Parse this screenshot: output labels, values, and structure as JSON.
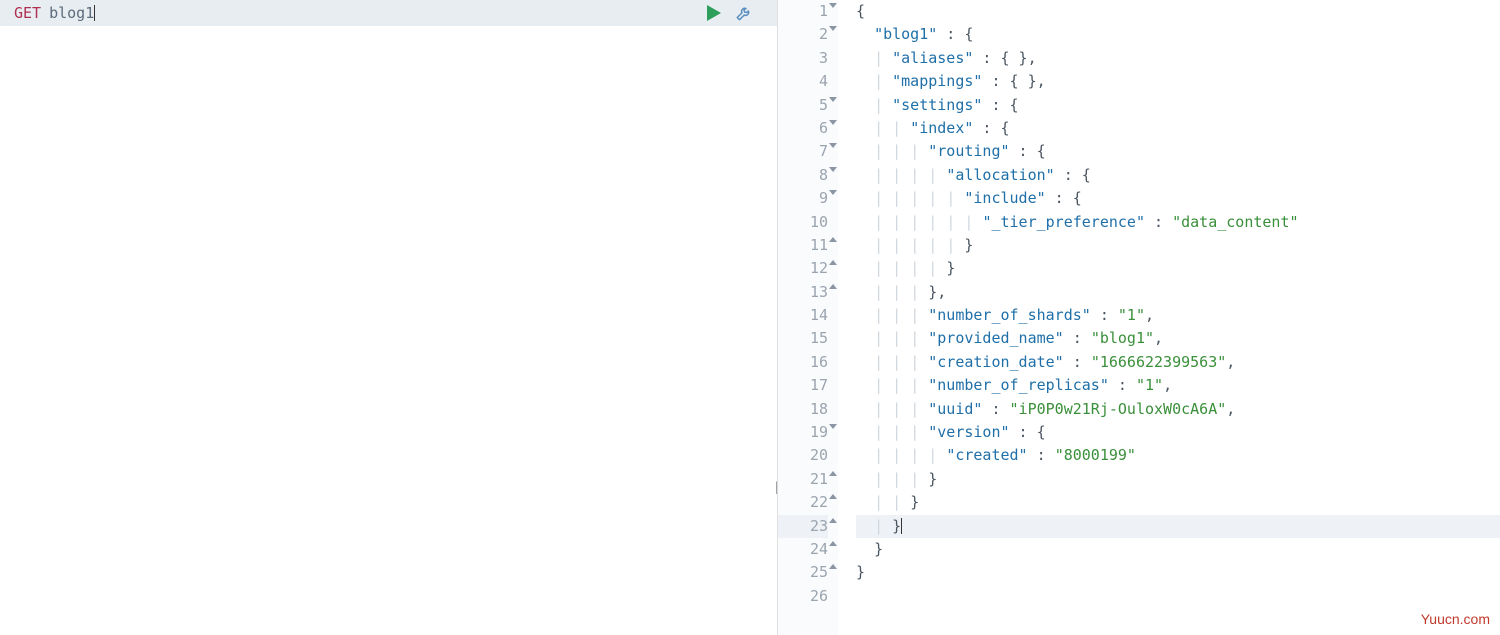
{
  "editor": {
    "method": "GET",
    "argument": "blog1"
  },
  "response": {
    "lines": [
      {
        "n": 1,
        "fold": "open",
        "indent": 0,
        "guides": 0,
        "tokens": [
          [
            "punc",
            "{"
          ]
        ]
      },
      {
        "n": 2,
        "fold": "open",
        "indent": 1,
        "guides": 0,
        "tokens": [
          [
            "key",
            "\"blog1\""
          ],
          [
            "punc",
            " : {"
          ]
        ]
      },
      {
        "n": 3,
        "fold": null,
        "indent": 2,
        "guides": 1,
        "tokens": [
          [
            "key",
            "\"aliases\""
          ],
          [
            "punc",
            " : { },"
          ]
        ]
      },
      {
        "n": 4,
        "fold": null,
        "indent": 2,
        "guides": 1,
        "tokens": [
          [
            "key",
            "\"mappings\""
          ],
          [
            "punc",
            " : { },"
          ]
        ]
      },
      {
        "n": 5,
        "fold": "open",
        "indent": 2,
        "guides": 1,
        "tokens": [
          [
            "key",
            "\"settings\""
          ],
          [
            "punc",
            " : {"
          ]
        ]
      },
      {
        "n": 6,
        "fold": "open",
        "indent": 3,
        "guides": 2,
        "tokens": [
          [
            "key",
            "\"index\""
          ],
          [
            "punc",
            " : {"
          ]
        ]
      },
      {
        "n": 7,
        "fold": "open",
        "indent": 4,
        "guides": 3,
        "tokens": [
          [
            "key",
            "\"routing\""
          ],
          [
            "punc",
            " : {"
          ]
        ]
      },
      {
        "n": 8,
        "fold": "open",
        "indent": 5,
        "guides": 4,
        "tokens": [
          [
            "key",
            "\"allocation\""
          ],
          [
            "punc",
            " : {"
          ]
        ]
      },
      {
        "n": 9,
        "fold": "open",
        "indent": 6,
        "guides": 5,
        "tokens": [
          [
            "key",
            "\"include\""
          ],
          [
            "punc",
            " : {"
          ]
        ]
      },
      {
        "n": 10,
        "fold": null,
        "indent": 7,
        "guides": 6,
        "tokens": [
          [
            "key",
            "\"_tier_preference\""
          ],
          [
            "punc",
            " : "
          ],
          [
            "str",
            "\"data_content\""
          ]
        ]
      },
      {
        "n": 11,
        "fold": "close",
        "indent": 6,
        "guides": 6,
        "tokens": [
          [
            "punc",
            "}"
          ]
        ]
      },
      {
        "n": 12,
        "fold": "close",
        "indent": 5,
        "guides": 5,
        "tokens": [
          [
            "punc",
            "}"
          ]
        ]
      },
      {
        "n": 13,
        "fold": "close",
        "indent": 4,
        "guides": 4,
        "tokens": [
          [
            "punc",
            "},"
          ]
        ]
      },
      {
        "n": 14,
        "fold": null,
        "indent": 4,
        "guides": 3,
        "tokens": [
          [
            "key",
            "\"number_of_shards\""
          ],
          [
            "punc",
            " : "
          ],
          [
            "str",
            "\"1\""
          ],
          [
            "punc",
            ","
          ]
        ]
      },
      {
        "n": 15,
        "fold": null,
        "indent": 4,
        "guides": 3,
        "tokens": [
          [
            "key",
            "\"provided_name\""
          ],
          [
            "punc",
            " : "
          ],
          [
            "str",
            "\"blog1\""
          ],
          [
            "punc",
            ","
          ]
        ]
      },
      {
        "n": 16,
        "fold": null,
        "indent": 4,
        "guides": 3,
        "tokens": [
          [
            "key",
            "\"creation_date\""
          ],
          [
            "punc",
            " : "
          ],
          [
            "str",
            "\"1666622399563\""
          ],
          [
            "punc",
            ","
          ]
        ]
      },
      {
        "n": 17,
        "fold": null,
        "indent": 4,
        "guides": 3,
        "tokens": [
          [
            "key",
            "\"number_of_replicas\""
          ],
          [
            "punc",
            " : "
          ],
          [
            "str",
            "\"1\""
          ],
          [
            "punc",
            ","
          ]
        ]
      },
      {
        "n": 18,
        "fold": null,
        "indent": 4,
        "guides": 3,
        "tokens": [
          [
            "key",
            "\"uuid\""
          ],
          [
            "punc",
            " : "
          ],
          [
            "str",
            "\"iP0P0w21Rj-OuloxW0cA6A\""
          ],
          [
            "punc",
            ","
          ]
        ]
      },
      {
        "n": 19,
        "fold": "open",
        "indent": 4,
        "guides": 3,
        "tokens": [
          [
            "key",
            "\"version\""
          ],
          [
            "punc",
            " : {"
          ]
        ]
      },
      {
        "n": 20,
        "fold": null,
        "indent": 5,
        "guides": 4,
        "tokens": [
          [
            "key",
            "\"created\""
          ],
          [
            "punc",
            " : "
          ],
          [
            "str",
            "\"8000199\""
          ]
        ]
      },
      {
        "n": 21,
        "fold": "close",
        "indent": 4,
        "guides": 4,
        "tokens": [
          [
            "punc",
            "}"
          ]
        ]
      },
      {
        "n": 22,
        "fold": "close",
        "indent": 3,
        "guides": 3,
        "tokens": [
          [
            "punc",
            "}"
          ]
        ]
      },
      {
        "n": 23,
        "fold": "close",
        "indent": 2,
        "guides": 2,
        "hl": true,
        "cursor": true,
        "tokens": [
          [
            "punc",
            "}"
          ]
        ]
      },
      {
        "n": 24,
        "fold": "close",
        "indent": 1,
        "guides": 1,
        "tokens": [
          [
            "punc",
            "}"
          ]
        ]
      },
      {
        "n": 25,
        "fold": "close",
        "indent": 0,
        "guides": 0,
        "tokens": [
          [
            "punc",
            "}"
          ]
        ]
      },
      {
        "n": 26,
        "fold": null,
        "indent": 0,
        "guides": 0,
        "tokens": []
      }
    ]
  },
  "watermark": "Yuucn.com"
}
